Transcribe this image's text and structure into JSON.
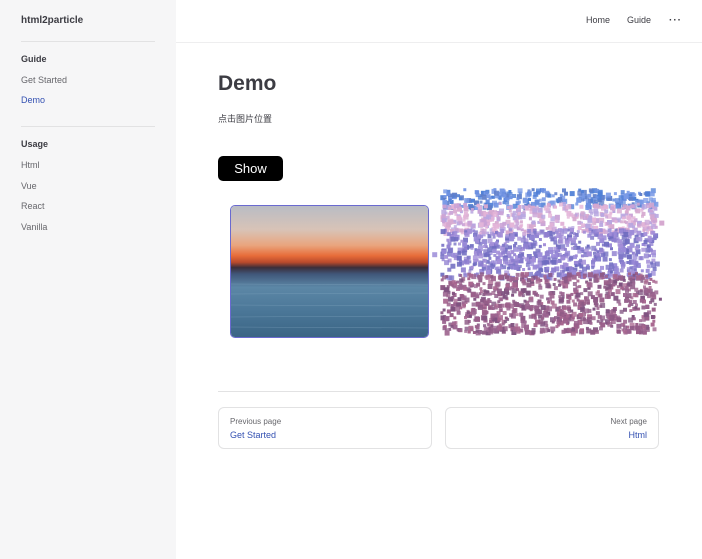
{
  "brand": "html2particle",
  "sidebar": {
    "sections": [
      {
        "title": "Guide",
        "items": [
          {
            "label": "Get Started",
            "active": false
          },
          {
            "label": "Demo",
            "active": true
          }
        ]
      },
      {
        "title": "Usage",
        "items": [
          {
            "label": "Html"
          },
          {
            "label": "Vue"
          },
          {
            "label": "React"
          },
          {
            "label": "Vanilla"
          }
        ]
      }
    ]
  },
  "nav": {
    "items": [
      "Home",
      "Guide"
    ],
    "more_label": "···"
  },
  "page": {
    "title": "Demo",
    "description": "点击图片位置",
    "button_label": "Show"
  },
  "pager": {
    "prev": {
      "desc": "Previous page",
      "label": "Get Started"
    },
    "next": {
      "desc": "Next page",
      "label": "Html"
    }
  },
  "colors": {
    "accent": "#3451b2",
    "sidebar_bg": "#f6f6f7",
    "button_bg": "#000000"
  }
}
